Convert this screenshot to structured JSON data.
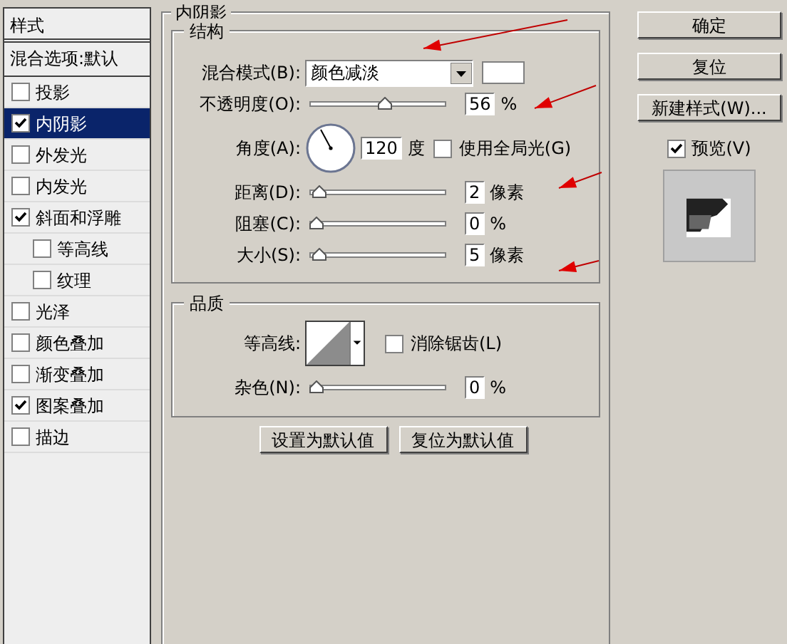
{
  "sidebar": {
    "title": "样式",
    "items": [
      {
        "label": "混合选项:默认",
        "kind": "header",
        "selected": false
      },
      {
        "label": "投影",
        "kind": "check",
        "checked": false,
        "selected": false
      },
      {
        "label": "内阴影",
        "kind": "check",
        "checked": true,
        "selected": true
      },
      {
        "label": "外发光",
        "kind": "check",
        "checked": false,
        "selected": false
      },
      {
        "label": "内发光",
        "kind": "check",
        "checked": false,
        "selected": false
      },
      {
        "label": "斜面和浮雕",
        "kind": "check",
        "checked": true,
        "selected": false,
        "children": [
          {
            "label": "等高线",
            "checked": false,
            "selected": false
          },
          {
            "label": "纹理",
            "checked": false,
            "selected": false
          }
        ]
      },
      {
        "label": "光泽",
        "kind": "check",
        "checked": false,
        "selected": false
      },
      {
        "label": "颜色叠加",
        "kind": "check",
        "checked": false,
        "selected": false
      },
      {
        "label": "渐变叠加",
        "kind": "check",
        "checked": false,
        "selected": false
      },
      {
        "label": "图案叠加",
        "kind": "check",
        "checked": true,
        "selected": false
      },
      {
        "label": "描边",
        "kind": "check",
        "checked": false,
        "selected": false
      }
    ]
  },
  "panel": {
    "title": "内阴影",
    "structure": {
      "title": "结构",
      "rows": [
        {
          "kind": "select",
          "label": "混合模式(B):",
          "value": "颜色减淡"
        },
        {
          "kind": "slider",
          "label": "不透明度(O):",
          "level": 0.56,
          "value": "56",
          "unit": "%"
        },
        {
          "kind": "angle",
          "label": "角度(A):",
          "value": "120",
          "unit": "度",
          "checkbox": {
            "label": "使用全局光(G)",
            "checked": false
          }
        },
        {
          "kind": "slider",
          "label": "距离(D):",
          "level": 0.02,
          "value": "2",
          "unit": "像素"
        },
        {
          "kind": "slider",
          "label": "阻塞(C):",
          "level": 0,
          "value": "0",
          "unit": "%"
        },
        {
          "kind": "slider",
          "label": "大小(S):",
          "level": 0.02,
          "value": "5",
          "unit": "像素"
        }
      ]
    },
    "quality": {
      "title": "品质",
      "contour_label": "等高线:",
      "antialias": {
        "label": "消除锯齿(L)",
        "checked": false
      },
      "noise": {
        "label": "杂色(N):",
        "level": 0,
        "value": "0",
        "unit": "%"
      }
    },
    "buttons": [
      "设置为默认值",
      "复位为默认值"
    ]
  },
  "actions": {
    "buttons": [
      "确定",
      "复位",
      "新建样式(W)..."
    ],
    "preview": {
      "label": "预览(V)",
      "checked": true
    }
  },
  "annotations": [
    {
      "kind": "arrow"
    },
    {
      "kind": "arrow"
    },
    {
      "kind": "arrow"
    },
    {
      "kind": "arrow"
    }
  ]
}
